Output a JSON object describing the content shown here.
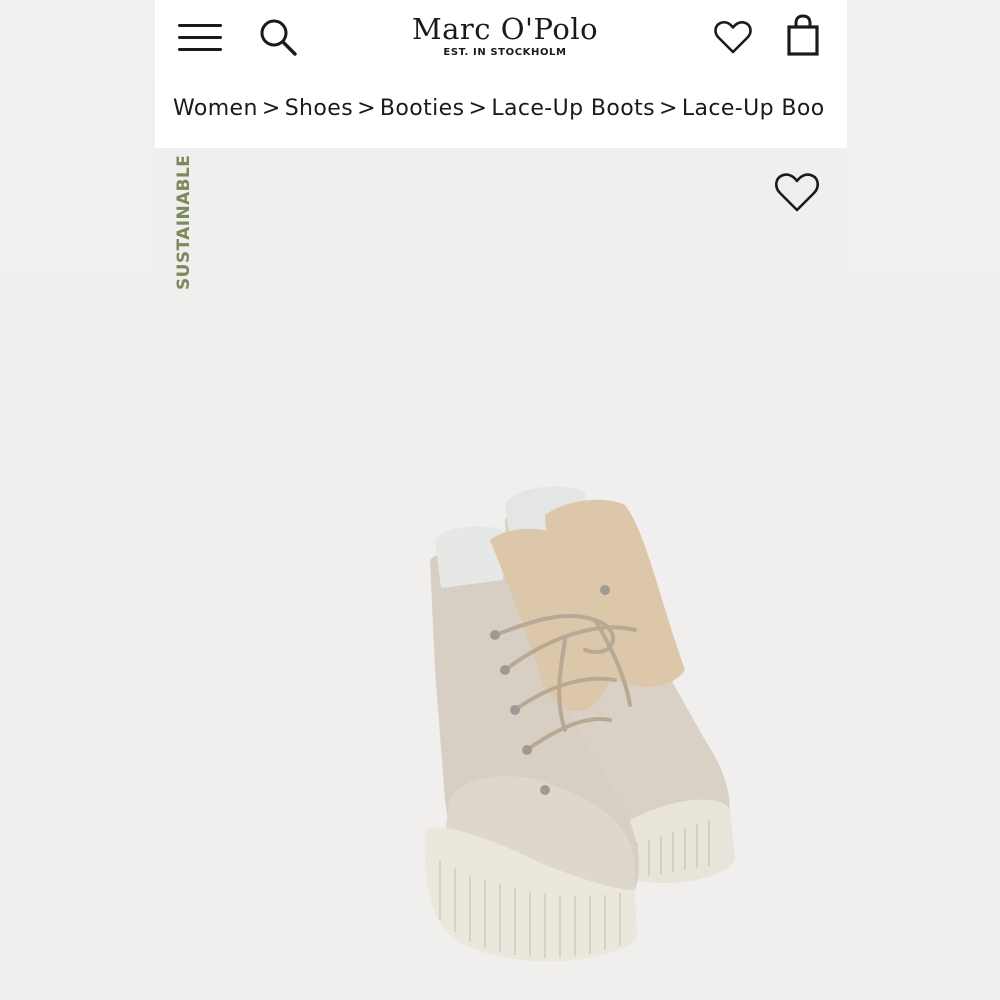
{
  "header": {
    "brand_name": "Marc O'Polo",
    "brand_tagline": "EST. IN STOCKHOLM",
    "menu_icon": "hamburger-menu-icon",
    "search_icon": "search-icon",
    "wishlist_icon": "heart-icon",
    "bag_icon": "shopping-bag-icon"
  },
  "breadcrumb": {
    "items": [
      "Women",
      "Shoes",
      "Booties",
      "Lace-Up Boots",
      "Lace-Up Boo"
    ],
    "separator": ">"
  },
  "product": {
    "badge": "SUSTAINABLE",
    "badge_color": "#7b8a5c",
    "wishlist_icon": "heart-icon",
    "image": "beige teddy-fleece lace-up boots"
  }
}
